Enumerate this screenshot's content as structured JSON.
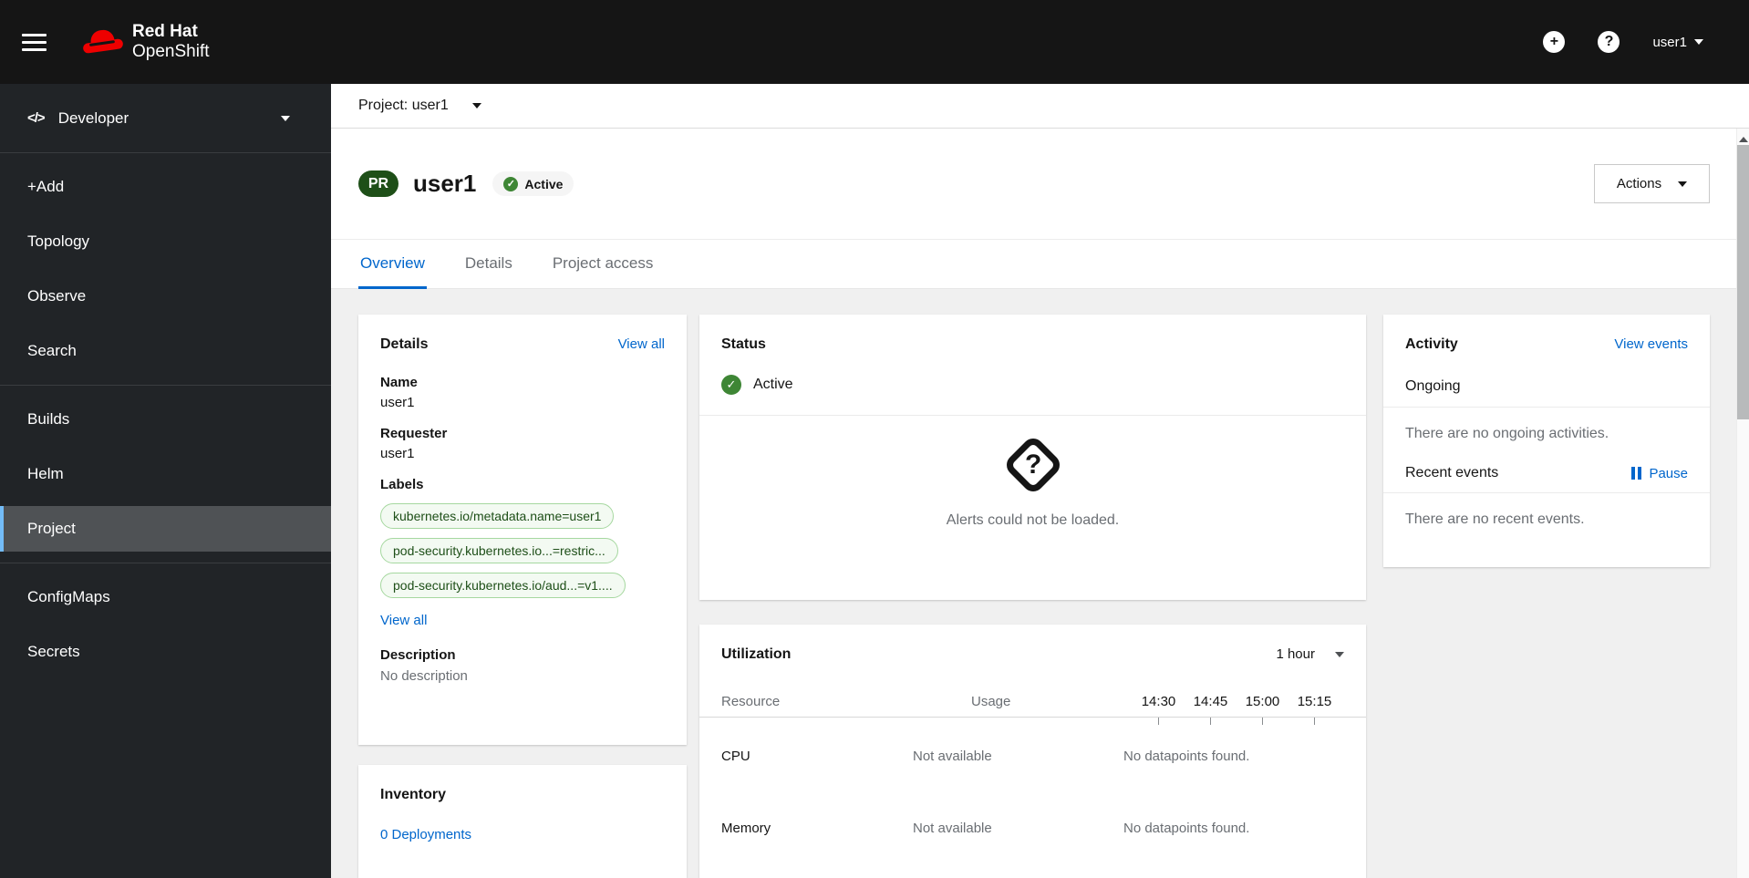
{
  "masthead": {
    "brand_line1": "Red Hat",
    "brand_line2": "OpenShift",
    "user": "user1"
  },
  "sidebar": {
    "perspective": "Developer",
    "groups": [
      {
        "items": [
          {
            "label": "+Add"
          },
          {
            "label": "Topology"
          },
          {
            "label": "Observe"
          },
          {
            "label": "Search"
          }
        ]
      },
      {
        "items": [
          {
            "label": "Builds"
          },
          {
            "label": "Helm"
          },
          {
            "label": "Project",
            "selected": true
          }
        ]
      },
      {
        "items": [
          {
            "label": "ConfigMaps"
          },
          {
            "label": "Secrets"
          }
        ]
      }
    ]
  },
  "toolbar": {
    "project_selector": "Project: user1"
  },
  "header": {
    "badge": "PR",
    "title": "user1",
    "status": "Active",
    "actions_label": "Actions"
  },
  "tabs": [
    {
      "label": "Overview",
      "active": true
    },
    {
      "label": "Details",
      "active": false
    },
    {
      "label": "Project access",
      "active": false
    }
  ],
  "details_card": {
    "title": "Details",
    "view_all": "View all",
    "name_label": "Name",
    "name_value": "user1",
    "requester_label": "Requester",
    "requester_value": "user1",
    "labels_label": "Labels",
    "labels": [
      "kubernetes.io/metadata.name=user1",
      "pod-security.kubernetes.io...=restric...",
      "pod-security.kubernetes.io/aud...=v1...."
    ],
    "labels_view_all": "View all",
    "description_label": "Description",
    "description_value": "No description"
  },
  "inventory_card": {
    "title": "Inventory",
    "deployments_link": "0 Deployments"
  },
  "status_card": {
    "title": "Status",
    "status": "Active",
    "alert_message": "Alerts could not be loaded."
  },
  "utilization_card": {
    "title": "Utilization",
    "duration": "1 hour",
    "resource_col": "Resource",
    "usage_col": "Usage",
    "times": [
      "14:30",
      "14:45",
      "15:00",
      "15:15"
    ],
    "rows": [
      {
        "resource": "CPU",
        "usage": "Not available",
        "chart": "No datapoints found."
      },
      {
        "resource": "Memory",
        "usage": "Not available",
        "chart": "No datapoints found."
      }
    ]
  },
  "activity_card": {
    "title": "Activity",
    "view_events": "View events",
    "ongoing_label": "Ongoing",
    "ongoing_empty": "There are no ongoing activities.",
    "recent_label": "Recent events",
    "pause_label": "Pause",
    "recent_empty": "There are no recent events."
  },
  "colors": {
    "accent_blue": "#0066cc",
    "status_green": "#3e8635",
    "project_badge_green": "#1e4f18",
    "label_pill_bg": "#f3faf2",
    "label_pill_border": "#a6d8a0",
    "masthead_bg": "#151515",
    "sidebar_bg": "#212427",
    "sidebar_selected_bg": "#4f5255",
    "sidebar_selected_bar": "#73bcf7",
    "content_bg": "#f0f0f0",
    "muted_text": "#6a6e73",
    "brand_red": "#ee0000"
  }
}
